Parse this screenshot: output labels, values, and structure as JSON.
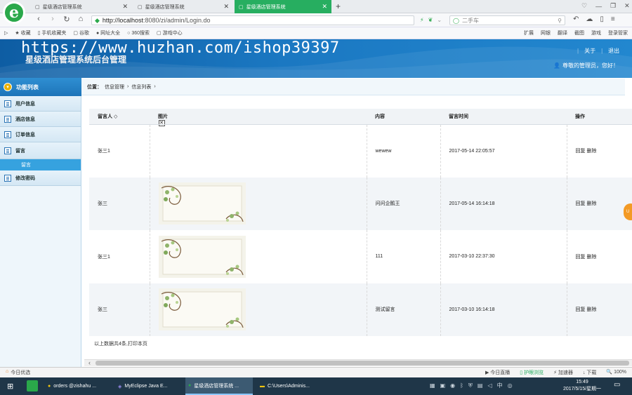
{
  "browser": {
    "tabs": [
      {
        "title": "星级酒店管理系统",
        "active": false
      },
      {
        "title": "星级酒店管理系统",
        "active": false
      },
      {
        "title": "星级酒店管理系统",
        "active": true
      }
    ],
    "new_tab": "+",
    "url_host": "http://localhost",
    "url_rest": ":8080/zi/admin/Login.do",
    "search_placeholder": "二手车",
    "bookmarks": [
      "收藏",
      "手机收藏夹",
      "谷歌",
      "网址大全",
      "360搜索",
      "游戏中心"
    ],
    "right_tools": [
      "扩展",
      "网银",
      "翻译",
      "截图",
      "游戏",
      "登录管家"
    ]
  },
  "watermark": "https://www.huzhan.com/ishop39397",
  "header": {
    "system_name": "星级酒店管理系统后台管理",
    "about": "关于",
    "logout": "退出",
    "welcome": "尊敬的管理员，您好！"
  },
  "sidebar": {
    "title": "功能列表",
    "items": [
      {
        "label": "用户信息"
      },
      {
        "label": "酒店信息"
      },
      {
        "label": "订单信息"
      },
      {
        "label": "留言"
      },
      {
        "label": "修改密码"
      }
    ],
    "sub_item": "留言"
  },
  "breadcrumb": {
    "prefix": "位置：",
    "level1": "信息管理",
    "level2": "信息列表"
  },
  "table": {
    "headers": [
      "留言人",
      "图片",
      "内容",
      "留言时间",
      "操作"
    ],
    "sort_indicator": "◇",
    "rows": [
      {
        "user": "张三1",
        "image": "broken",
        "content": "wewew",
        "time": "2017-05-14 22:05:57",
        "reply": "回复",
        "delete": "删除"
      },
      {
        "user": "张三",
        "image": "thumb",
        "content": "问问企鹅王",
        "time": "2017-05-14 16:14:18",
        "reply": "回复",
        "delete": "删除"
      },
      {
        "user": "张三1",
        "image": "thumb",
        "content": "111",
        "time": "2017-03-10 22:37:30",
        "reply": "回复",
        "delete": "删除"
      },
      {
        "user": "张三",
        "image": "thumb",
        "content": "测试留言",
        "time": "2017-03-10 16:14:18",
        "reply": "回复",
        "delete": "删除"
      }
    ]
  },
  "footnote": "以上数据共4条,打印本页",
  "statusbar": {
    "left": "今日优选",
    "items": [
      "今日直播",
      "护眼浏览",
      "加速器",
      "下载"
    ],
    "zoom": "100%"
  },
  "taskbar": {
    "apps": [
      {
        "label": "orders @zishahu ..."
      },
      {
        "label": "MyEclipse Java E..."
      },
      {
        "label": "星级酒店管理系统 ..."
      },
      {
        "label": "C:\\Users\\Adminis..."
      }
    ],
    "ime": "中",
    "time": "15:49",
    "date": "2017/5/15/星期一"
  },
  "colors": {
    "accent": "#27ae60",
    "header_blue": "#1b78c2",
    "sidebar_active": "#36a2df"
  }
}
